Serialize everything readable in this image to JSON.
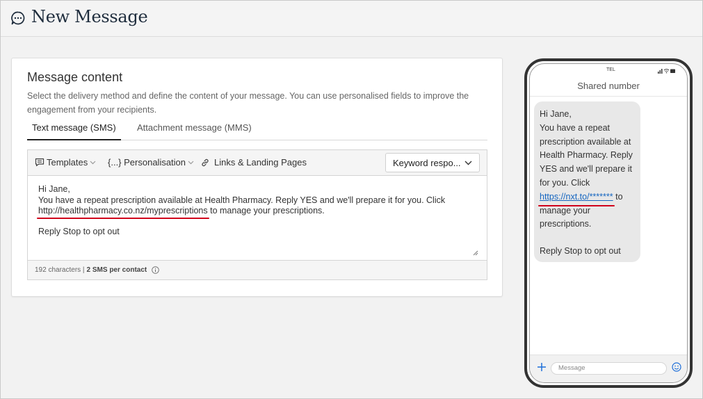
{
  "header": {
    "title": "New Message",
    "icon": "chat-bubble-icon"
  },
  "content": {
    "title": "Message content",
    "description": "Select the delivery method and define the content of your message. You can use personalised fields to improve the engagement from your recipients.",
    "tabs": [
      {
        "label": "Text message (SMS)",
        "active": true
      },
      {
        "label": "Attachment message (MMS)",
        "active": false
      }
    ]
  },
  "toolbar": {
    "templates_label": "Templates",
    "personalisation_label": "{...} Personalisation",
    "links_label": "Links & Landing Pages",
    "keyword_label": "Keyword respo..."
  },
  "message": {
    "greeting": "Hi Jane,",
    "body": "You have a repeat prescription available at Health Pharmacy. Reply YES and we'll prepare it for you. Click",
    "link": "http://healthpharmacy.co.nz/myprescriptions",
    "after_link": " to manage your prescriptions.",
    "optout": "Reply Stop to opt out"
  },
  "footer": {
    "char_count": "192 characters |",
    "sms_count": "2 SMS per contact"
  },
  "phone": {
    "carrier": "TEL",
    "sender": "Shared number",
    "bubble_greeting": "Hi Jane,",
    "bubble_body": "You have a repeat prescription available at Health Pharmacy. Reply YES and we'll prepare it for you. Click",
    "bubble_link": "https://nxt.to/*******",
    "bubble_after_link": " to manage your prescriptions.",
    "bubble_optout": "Reply Stop to opt out",
    "input_placeholder": "Message"
  },
  "colors": {
    "accent_red": "#d0021b",
    "link_blue": "#1565c0",
    "phone_frame": "#333333"
  }
}
